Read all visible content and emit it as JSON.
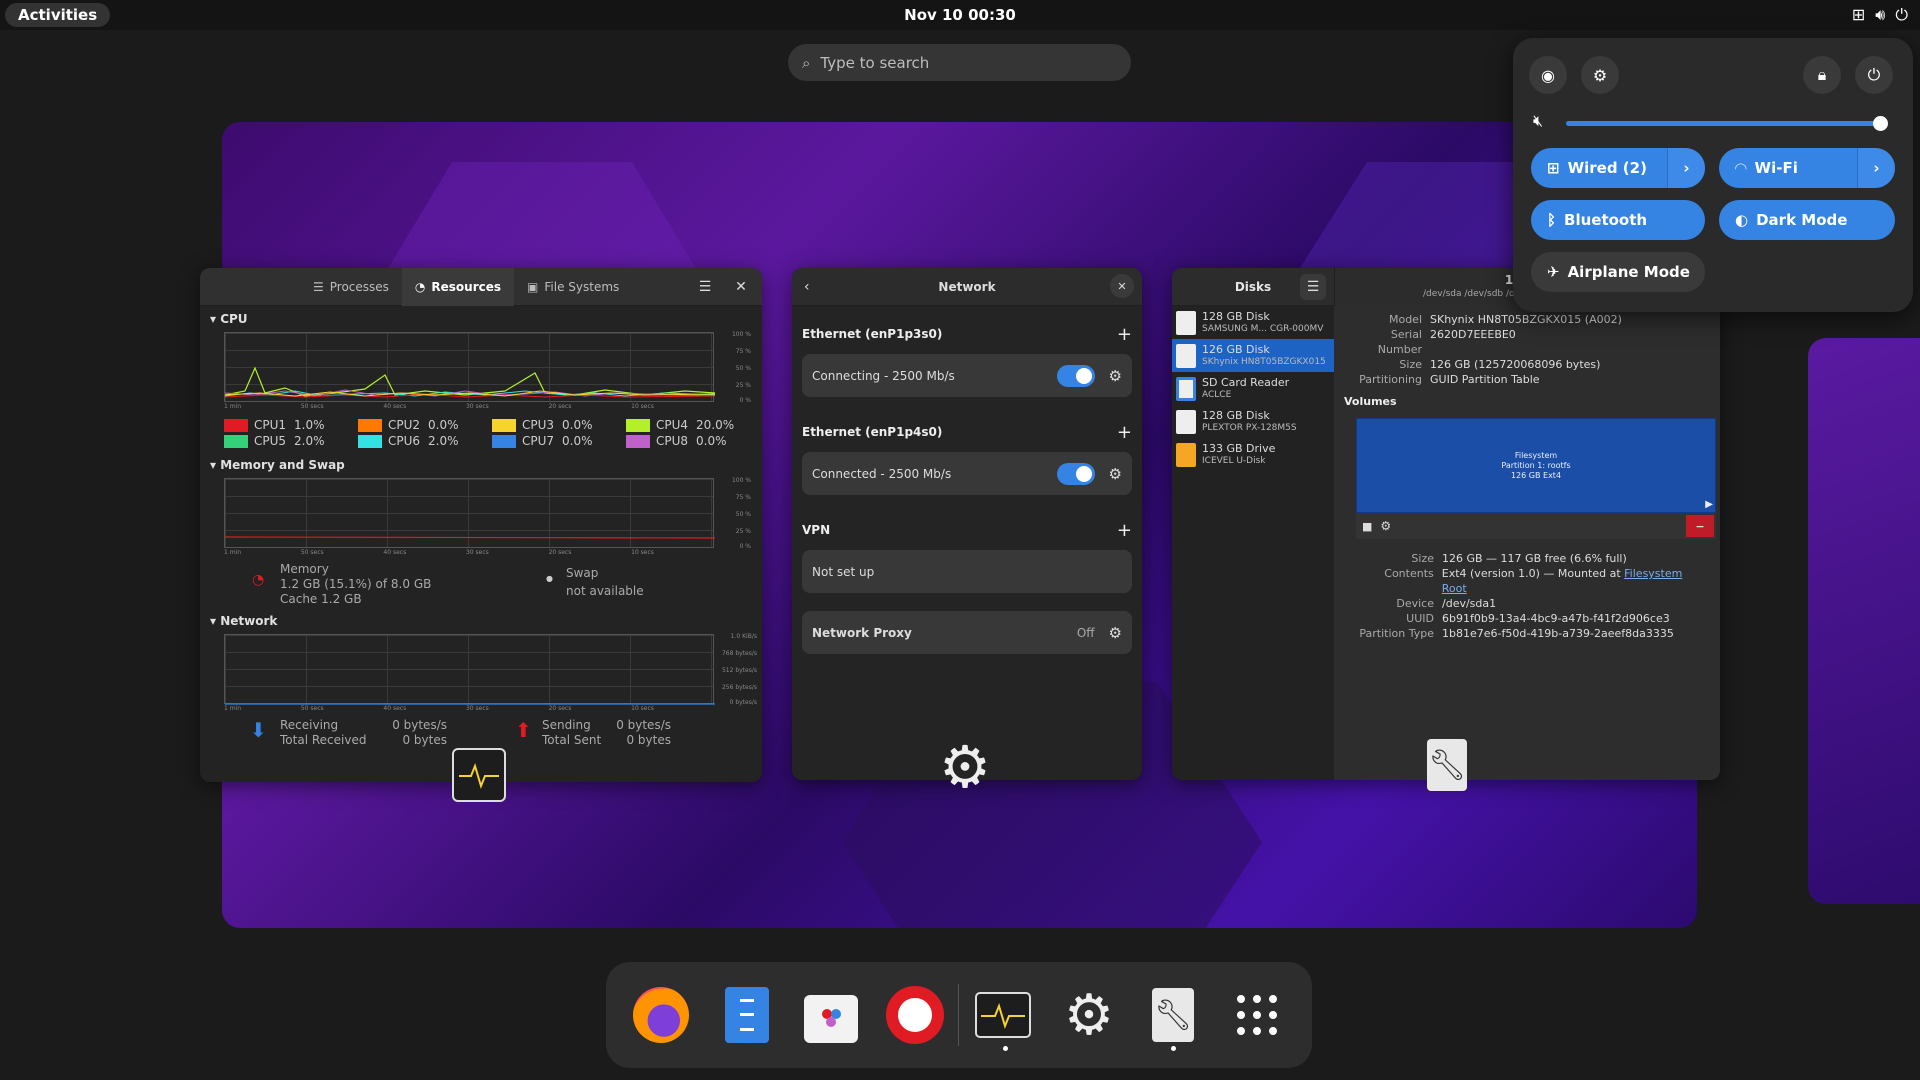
{
  "topbar": {
    "activities": "Activities",
    "clock": "Nov 10  00:30"
  },
  "search": {
    "placeholder": "Type to search"
  },
  "sysmon": {
    "tabs": [
      "Processes",
      "Resources",
      "File Systems"
    ],
    "cpu_title": "CPU",
    "mem_title": "Memory and Swap",
    "net_title": "Network",
    "x_ticks": [
      "1 min",
      "50 secs",
      "40 secs",
      "30 secs",
      "20 secs",
      "10 secs"
    ],
    "pct_ticks": [
      "100 %",
      "75 %",
      "50 %",
      "25 %",
      "0 %"
    ],
    "net_ticks": [
      "1.0 KiB/s",
      "768 bytes/s",
      "512 bytes/s",
      "256 bytes/s",
      "0 bytes/s"
    ],
    "cpus": [
      {
        "name": "CPU1",
        "value": "1.0%",
        "color": "#e01b24"
      },
      {
        "name": "CPU2",
        "value": "0.0%",
        "color": "#ff7800"
      },
      {
        "name": "CPU3",
        "value": "0.0%",
        "color": "#f6d32d"
      },
      {
        "name": "CPU4",
        "value": "20.0%",
        "color": "#b3f02a"
      },
      {
        "name": "CPU5",
        "value": "2.0%",
        "color": "#33d17a"
      },
      {
        "name": "CPU6",
        "value": "2.0%",
        "color": "#33e3e3"
      },
      {
        "name": "CPU7",
        "value": "0.0%",
        "color": "#3584e4"
      },
      {
        "name": "CPU8",
        "value": "0.0%",
        "color": "#c061cb"
      }
    ],
    "memory": {
      "label": "Memory",
      "used": "1.2 GB (15.1%) of 8.0 GB",
      "cache": "Cache 1.2 GB"
    },
    "swap": {
      "label": "Swap",
      "value": "not available"
    },
    "receiving": {
      "label": "Receiving",
      "rate": "0 bytes/s",
      "total_label": "Total Received",
      "total": "0 bytes"
    },
    "sending": {
      "label": "Sending",
      "rate": "0 bytes/s",
      "total_label": "Total Sent",
      "total": "0 bytes"
    }
  },
  "network": {
    "title": "Network",
    "eth1": {
      "title": "Ethernet (enP1p3s0)",
      "status": "Connecting - 2500 Mb/s"
    },
    "eth2": {
      "title": "Ethernet (enP1p4s0)",
      "status": "Connected - 2500 Mb/s"
    },
    "vpn": {
      "title": "VPN",
      "status": "Not set up"
    },
    "proxy": {
      "label": "Network Proxy",
      "value": "Off"
    }
  },
  "disks": {
    "title": "Disks",
    "header_title": "126 G",
    "header_sub": "/dev/sda /dev/sdb /dev/sdc",
    "list": [
      {
        "name": "128 GB Disk",
        "sub": "SAMSUNG M...  CGR-000MV"
      },
      {
        "name": "126 GB Disk",
        "sub": "SKhynix HN8T05BZGKX015"
      },
      {
        "name": "SD Card Reader",
        "sub": "ACLCE"
      },
      {
        "name": "128 GB Disk",
        "sub": "PLEXTOR PX-128M5S"
      },
      {
        "name": "133 GB Drive",
        "sub": "ICEVEL U-Disk"
      }
    ],
    "info": [
      {
        "k": "Model",
        "v": "SKhynix HN8T05BZGKX015 (A002)"
      },
      {
        "k": "Serial Number",
        "v": "2620D7EEEBE0"
      },
      {
        "k": "Size",
        "v": "126 GB (125720068096 bytes)"
      },
      {
        "k": "Partitioning",
        "v": "GUID Partition Table"
      }
    ],
    "volumes_title": "Volumes",
    "volume_label": [
      "Filesystem",
      "Partition 1: rootfs",
      "126 GB Ext4"
    ],
    "vol_info": {
      "size_k": "Size",
      "size": "126 GB — 117 GB free (6.6% full)",
      "contents_k": "Contents",
      "contents": "Ext4 (version 1.0) — Mounted at ",
      "contents_link": "Filesystem Root",
      "device_k": "Device",
      "device": "/dev/sda1",
      "uuid_k": "UUID",
      "uuid": "6b91f0b9-13a4-4bc9-a47b-f41f2d906ce3",
      "ptype_k": "Partition Type",
      "ptype": "1b81e7e6-f50d-419b-a739-2aeef8da3335"
    }
  },
  "quick_settings": {
    "wired": "Wired (2)",
    "wifi": "Wi-Fi",
    "bluetooth": "Bluetooth",
    "dark_mode": "Dark Mode",
    "airplane": "Airplane Mode",
    "volume": 1.0
  },
  "dock": {
    "apps": [
      "firefox-icon",
      "files-icon",
      "software-icon",
      "help-icon",
      "system-monitor-icon",
      "settings-icon",
      "disks-icon",
      "app-grid-icon"
    ]
  }
}
